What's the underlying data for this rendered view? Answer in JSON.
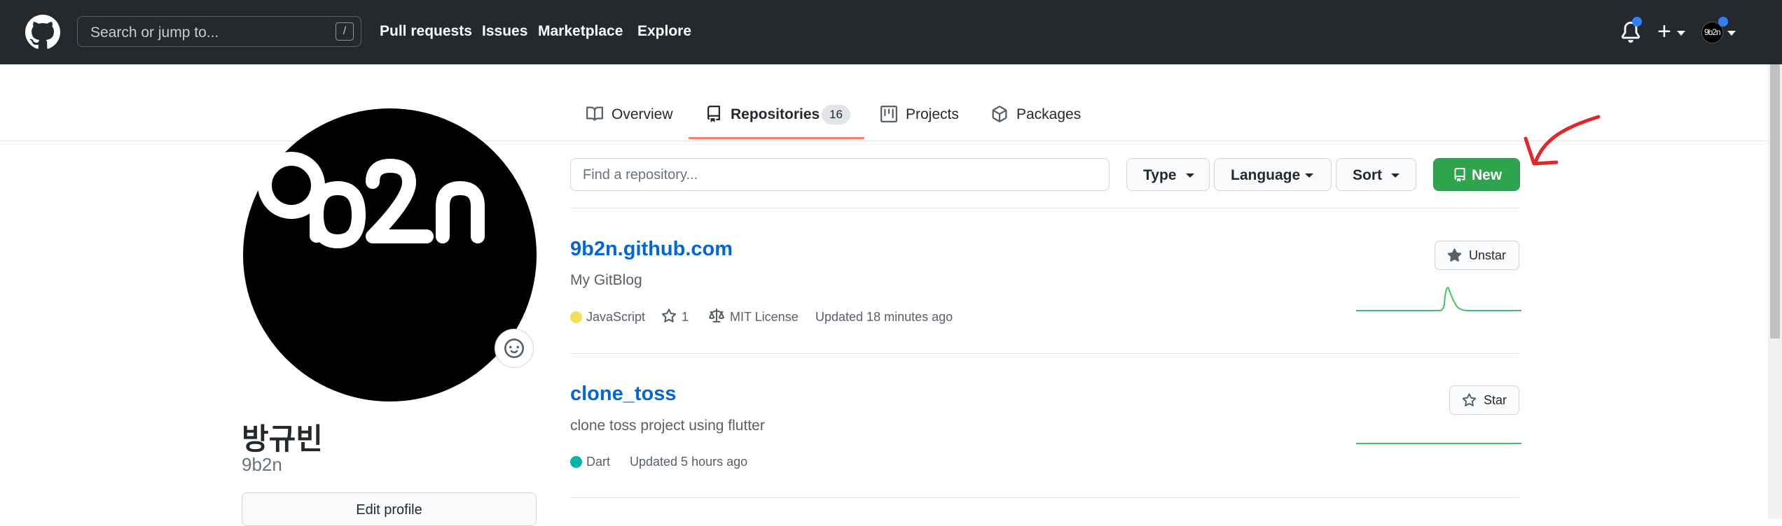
{
  "header": {
    "search_placeholder": "Search or jump to...",
    "search_shortcut": "/",
    "nav": [
      "Pull requests",
      "Issues",
      "Marketplace",
      "Explore"
    ],
    "avatar_text": "9b2n"
  },
  "tabs": [
    {
      "label": "Overview"
    },
    {
      "label": "Repositories",
      "count": "16",
      "selected": true
    },
    {
      "label": "Projects"
    },
    {
      "label": "Packages"
    }
  ],
  "profile": {
    "avatar_text": "9b2n",
    "name": "방규빈",
    "login": "9b2n",
    "edit_label": "Edit profile"
  },
  "toolbar": {
    "find_placeholder": "Find a repository...",
    "type_label": "Type",
    "language_label": "Language",
    "sort_label": "Sort",
    "new_label": "New"
  },
  "repos": [
    {
      "name": "9b2n.github.com",
      "description": "My GitBlog",
      "language": "JavaScript",
      "language_color": "#f1e05a",
      "stars": "1",
      "license": "MIT License",
      "updated": "Updated 18 minutes ago",
      "star_label": "Unstar"
    },
    {
      "name": "clone_toss",
      "description": "clone toss project using flutter",
      "language": "Dart",
      "language_color": "#00B4AB",
      "updated": "Updated 5 hours ago",
      "star_label": "Star"
    }
  ],
  "colors": {
    "header_bg": "#24292e",
    "link": "#0366d6",
    "new_button": "#2ea44f",
    "tab_underline": "#f9826c",
    "annotation": "#e3262c"
  }
}
